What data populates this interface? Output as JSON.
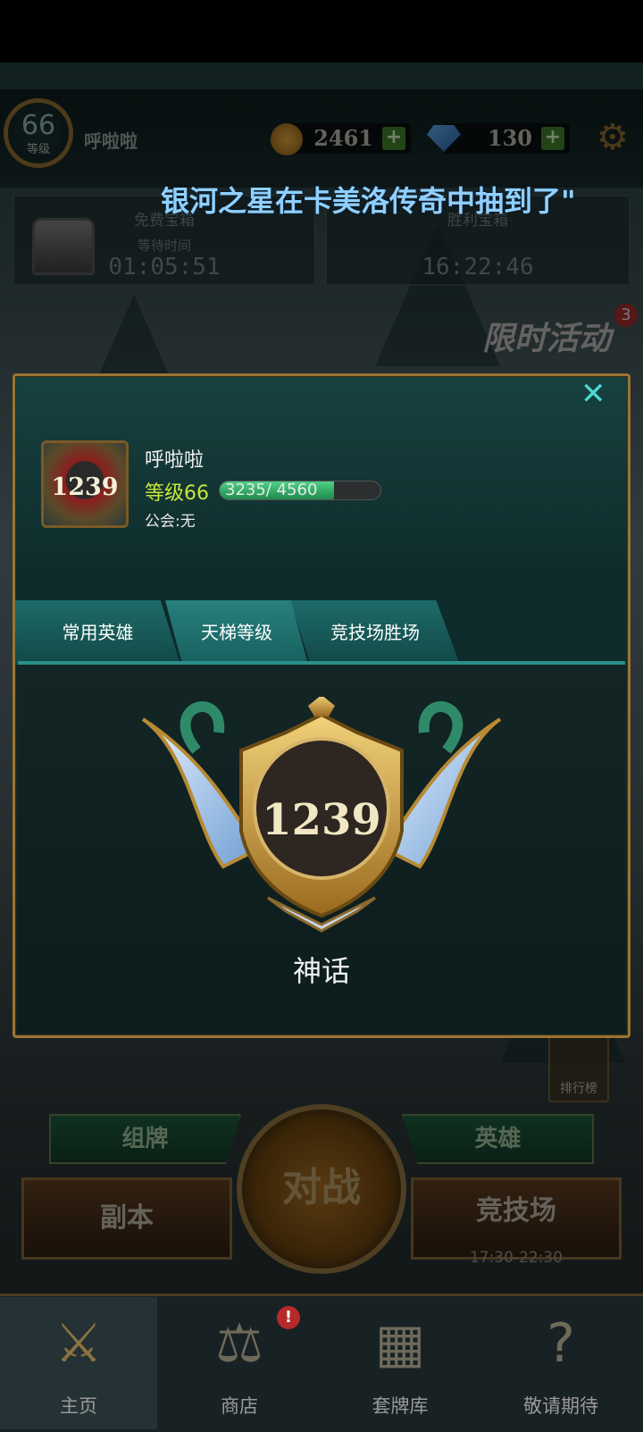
{
  "top_bar": {
    "level": "66",
    "level_label": "等级",
    "player_name": "呼啦啦",
    "gold": "2461",
    "gems": "130",
    "ticker": "银河之星在卡美洛传奇中抽到了\""
  },
  "chests": [
    {
      "title": "免费宝箱",
      "subtitle": "等待时间",
      "timer": "01:05:51"
    },
    {
      "title": "胜利宝箱",
      "subtitle": "",
      "timer": "16:22:46"
    }
  ],
  "event": {
    "label": "限时活动",
    "badge": "3"
  },
  "profile_modal": {
    "close_icon": "close-icon",
    "avatar_rating": "1239",
    "name": "呼啦啦",
    "level_text": "等级66",
    "xp_text": "3235/ 4560",
    "xp_fraction": 0.709,
    "guild": "公会:无",
    "tabs": [
      "常用英雄",
      "天梯等级",
      "竞技场胜场"
    ],
    "active_tab": 1,
    "rank_rating": "1239",
    "rank_name": "神话"
  },
  "lobby": {
    "ranking_label": "排行榜",
    "deck_button": "组牌",
    "hero_button": "英雄",
    "battle_button": "对战",
    "dungeon_button": "副本",
    "arena_button": "竞技场",
    "arena_hours": "17:30-22:30"
  },
  "bottom_nav": [
    {
      "label": "主页",
      "icon": "swords-icon"
    },
    {
      "label": "商店",
      "icon": "scales-icon"
    },
    {
      "label": "套牌库",
      "icon": "cards-icon"
    },
    {
      "label": "敬请期待",
      "icon": "question-icon"
    }
  ],
  "shop_alert": "!",
  "colors": {
    "accent_teal": "#4fd8d2",
    "level_green": "#c8e63b",
    "gold_border": "#9a7434"
  }
}
